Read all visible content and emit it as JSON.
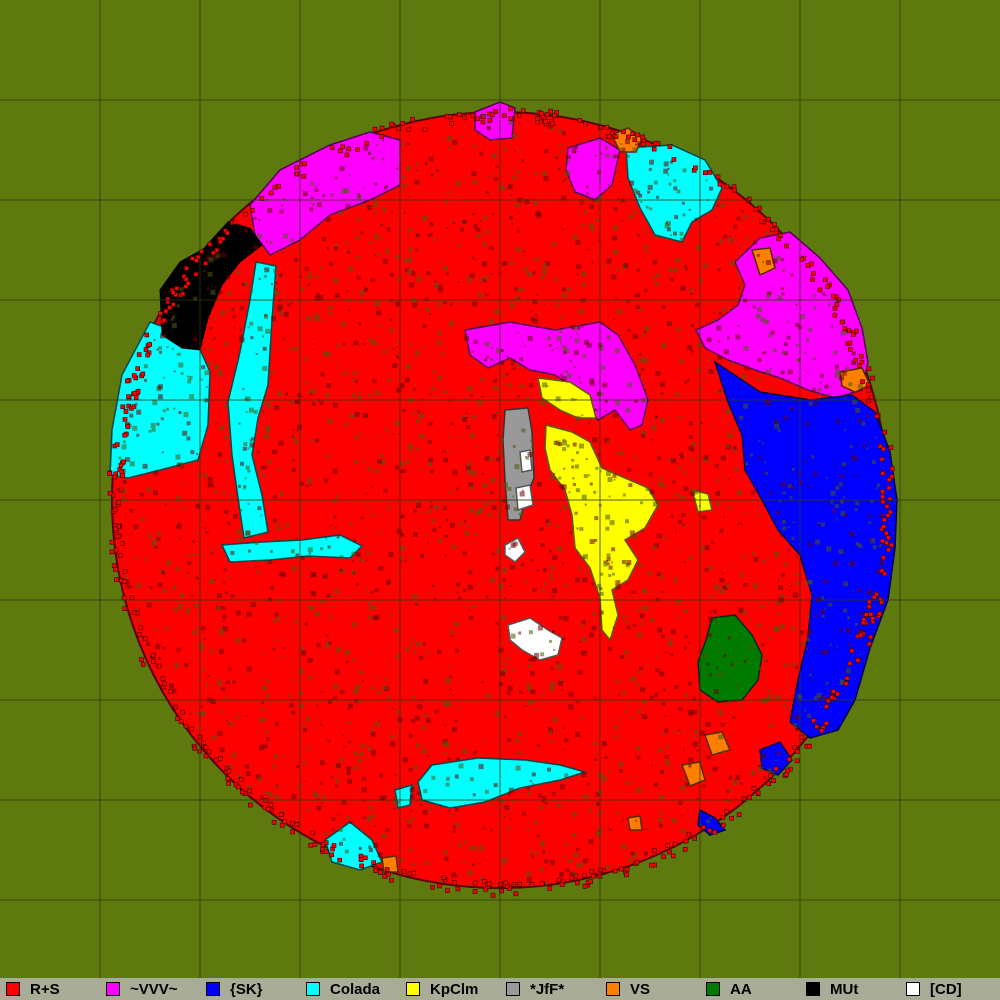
{
  "colors": {
    "background": "#5e7a0e",
    "grid": "#2d3a08",
    "territory_base": "#ff0000",
    "pixel_border": "#330000",
    "legend_bg": "#a9ad97"
  },
  "factions": [
    {
      "name": "R+S",
      "color": "#ff0000"
    },
    {
      "name": "~VVV~",
      "color": "#ff00ff"
    },
    {
      "name": "{SK}",
      "color": "#0000ff"
    },
    {
      "name": "Colada",
      "color": "#00ffff"
    },
    {
      "name": "KpClm",
      "color": "#ffff00"
    },
    {
      "name": "*JfF*",
      "color": "#999999"
    },
    {
      "name": "VS",
      "color": "#ff8000"
    },
    {
      "name": "AA",
      "color": "#007a00"
    },
    {
      "name": "MUt",
      "color": "#000000"
    },
    {
      "name": "[CD]",
      "color": "#ffffff"
    }
  ]
}
